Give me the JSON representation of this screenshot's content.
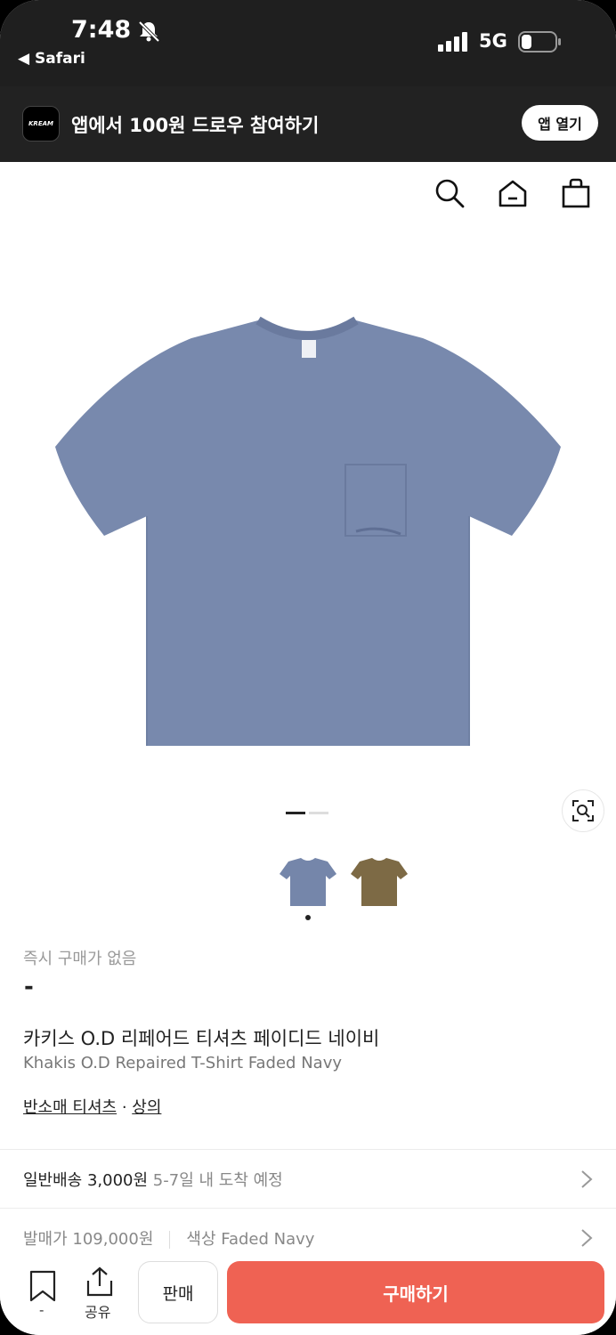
{
  "status_bar": {
    "time": "7:48",
    "back_app": "◀ Safari",
    "network": "5G"
  },
  "banner": {
    "logo_text": "KREAM",
    "text": "앱에서 100원 드로우 참여하기",
    "open_button": "앱 열기"
  },
  "header": {
    "icons": [
      "search-icon",
      "home-icon",
      "shopping-bag-icon"
    ]
  },
  "product": {
    "image_color": "#7a8caf",
    "pager_total": 2,
    "pager_active": 1,
    "thumbnails": [
      {
        "name": "faded-navy",
        "color": "#7586aa"
      },
      {
        "name": "olive",
        "color": "#7d6a45"
      }
    ],
    "instant_buy_label": "즉시 구매가 없음",
    "price": "-",
    "name_ko": "카키스 O.D 리페어드 티셔츠 페이디드 네이비",
    "name_en": "Khakis O.D Repaired T-Shirt Faded Navy",
    "category_1": "반소매 티셔츠",
    "category_sep": " · ",
    "category_2": "상의"
  },
  "shipping": {
    "label": "일반배송 3,000원",
    "eta": "5-7일 내 도착 예정"
  },
  "details": {
    "release_price": "발매가 109,000원",
    "color": "색상 Faded Navy"
  },
  "bottom_bar": {
    "bookmark_count": "-",
    "share_label": "공유",
    "sell_label": "판매",
    "buy_label": "구매하기",
    "buy_color": "#ef6253"
  }
}
